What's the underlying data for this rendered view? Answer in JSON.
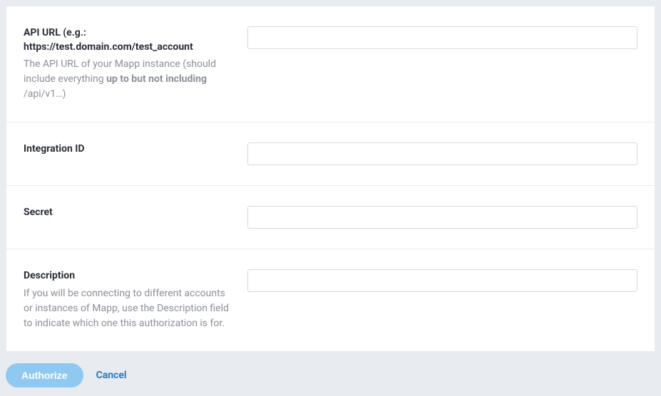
{
  "fields": {
    "api_url": {
      "label": "API URL (e.g.: https://test.domain.com/test_account",
      "help_before": "The API URL of your Mapp instance (should include everything ",
      "help_bold": "up to but not including",
      "help_after": " /api/v1…)",
      "value": ""
    },
    "integration_id": {
      "label": "Integration ID",
      "value": ""
    },
    "secret": {
      "label": "Secret",
      "value": ""
    },
    "description": {
      "label": "Description",
      "help": "If you will be connecting to different accounts or instances of Mapp, use the Description field to indicate which one this authorization is for.",
      "value": ""
    }
  },
  "actions": {
    "authorize": "Authorize",
    "cancel": "Cancel"
  }
}
